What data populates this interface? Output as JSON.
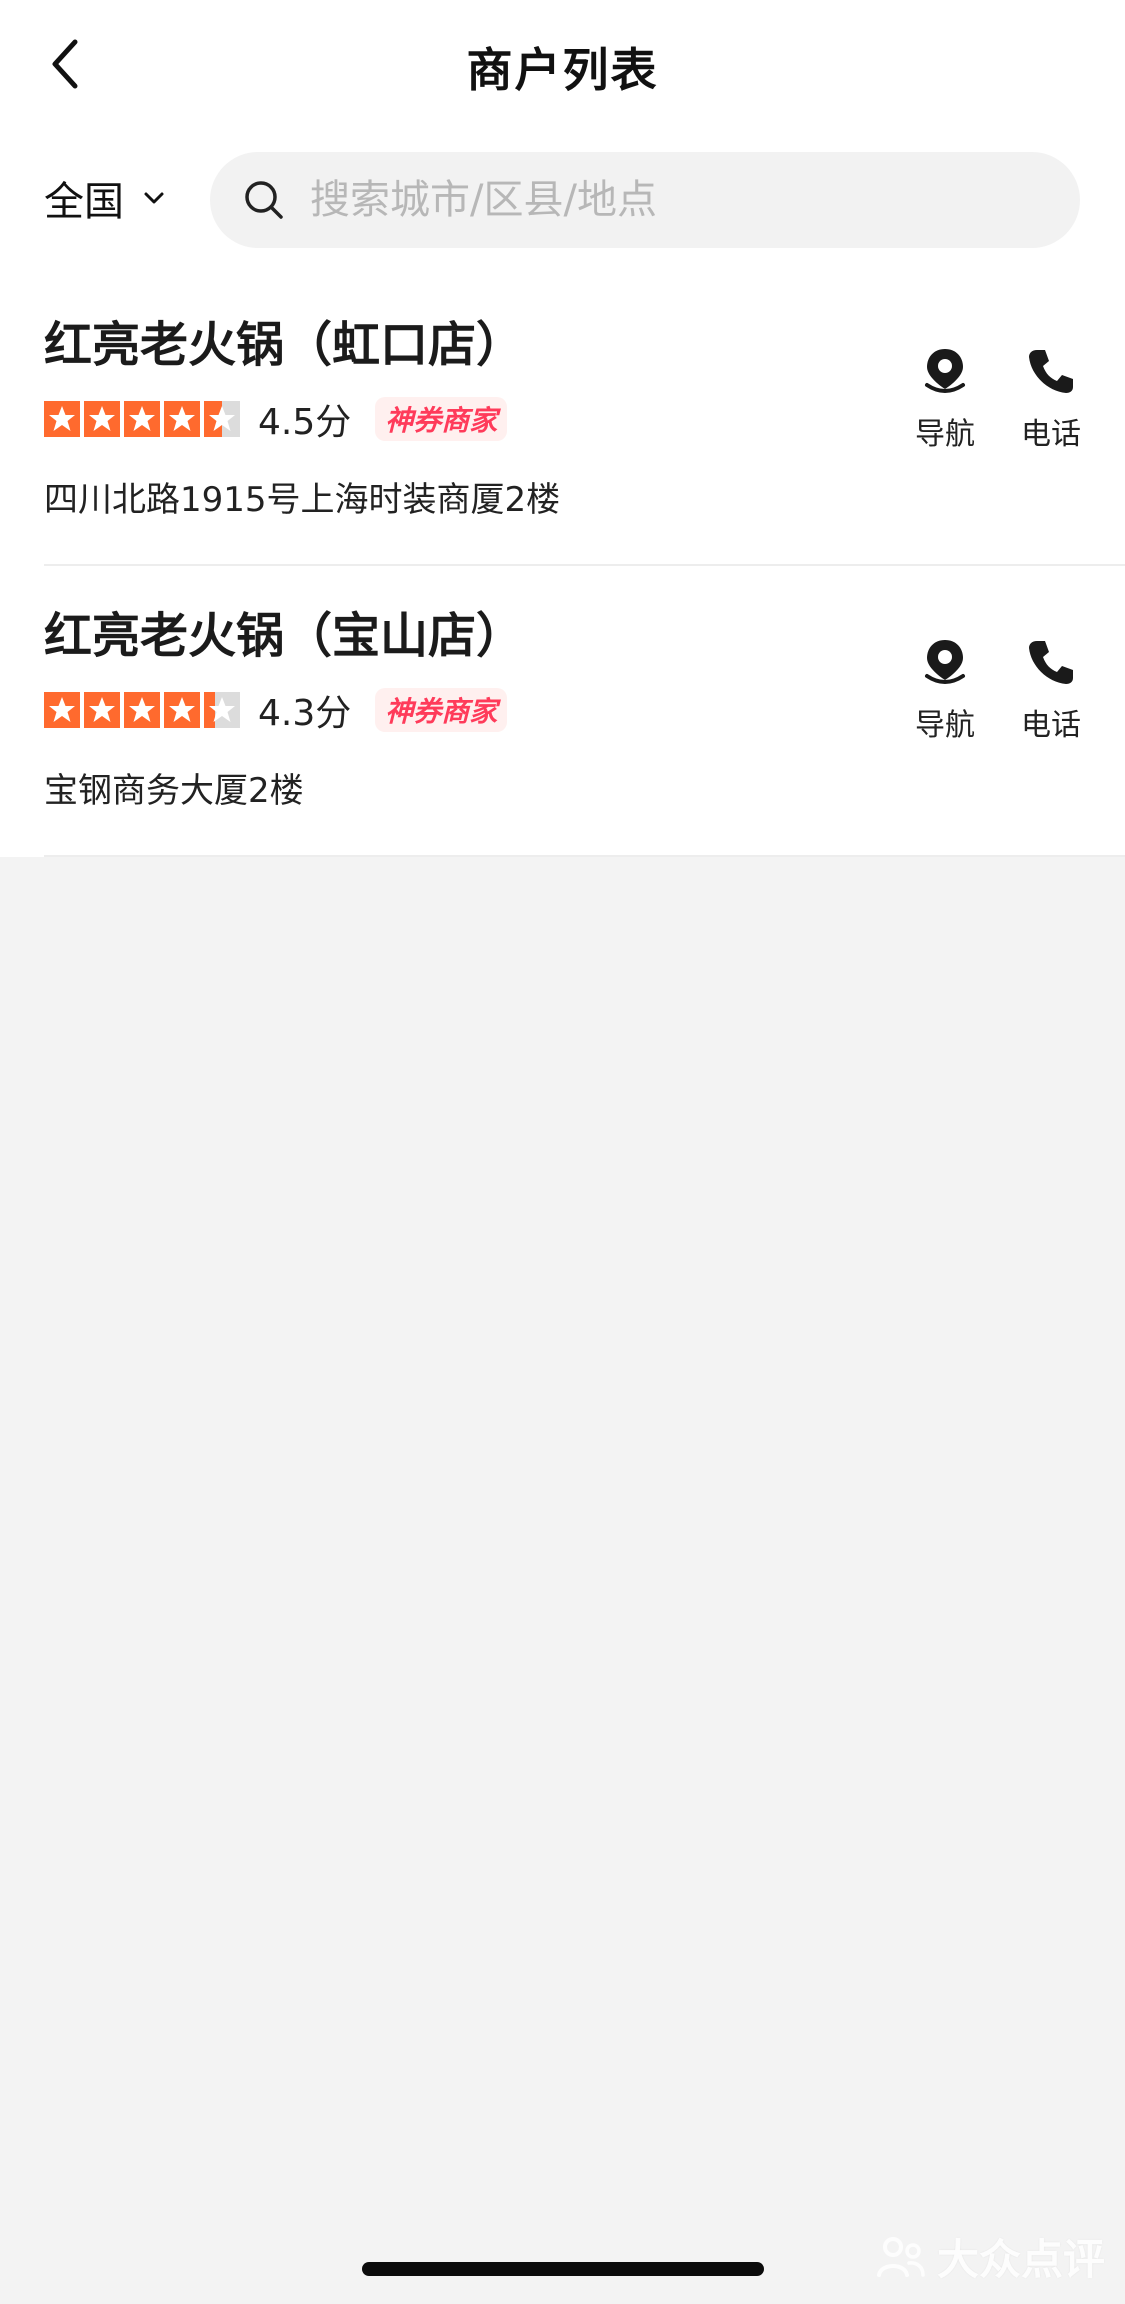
{
  "header": {
    "title": "商户列表",
    "back_icon": "chevron-left-icon"
  },
  "filter": {
    "region": "全国",
    "search_placeholder": "搜索城市/区县/地点"
  },
  "shops": [
    {
      "name": "红亮老火锅（虹口店）",
      "rating": 4.5,
      "score_text": "4.5分",
      "badge": "神券商家",
      "address": "四川北路1915号上海时装商厦2楼",
      "nav_label": "导航",
      "phone_label": "电话"
    },
    {
      "name": "红亮老火锅（宝山店）",
      "rating": 4.3,
      "score_text": "4.3分",
      "badge": "神券商家",
      "address": "宝钢商务大厦2楼",
      "nav_label": "导航",
      "phone_label": "电话"
    }
  ],
  "watermark": "大众点评",
  "colors": {
    "star": "#ff6a2e",
    "star_empty": "#dcdcdc",
    "badge_text": "#ff3b5a",
    "background": "#f3f3f3"
  }
}
